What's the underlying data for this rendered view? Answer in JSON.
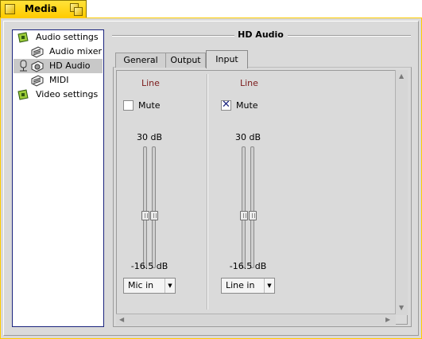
{
  "window": {
    "title": "Media"
  },
  "sidebar": {
    "items": [
      {
        "label": "Audio settings",
        "icon": "settings-page-icon"
      },
      {
        "label": "Audio mixer",
        "icon": "speaker-box-icon"
      },
      {
        "label": "HD Audio",
        "icon": "speaker-box-icon",
        "selected": true
      },
      {
        "label": "MIDI",
        "icon": "speaker-box-icon"
      },
      {
        "label": "Video settings",
        "icon": "settings-page-icon"
      }
    ]
  },
  "panel": {
    "title": "HD Audio",
    "tabs": [
      {
        "label": "General"
      },
      {
        "label": "Output"
      },
      {
        "label": "Input",
        "active": true
      }
    ],
    "channels": [
      {
        "label": "Line",
        "mute_label": "Mute",
        "muted": false,
        "max": "30 dB",
        "min": "-16.5 dB",
        "source": "Mic in"
      },
      {
        "label": "Line",
        "mute_label": "Mute",
        "muted": true,
        "max": "30 dB",
        "min": "-16.5 dB",
        "source": "Line in"
      }
    ]
  },
  "colors": {
    "tab_yellow": "#ffcb00",
    "channel_label": "#7b1b1b",
    "sidebar_border": "#1a237e"
  }
}
